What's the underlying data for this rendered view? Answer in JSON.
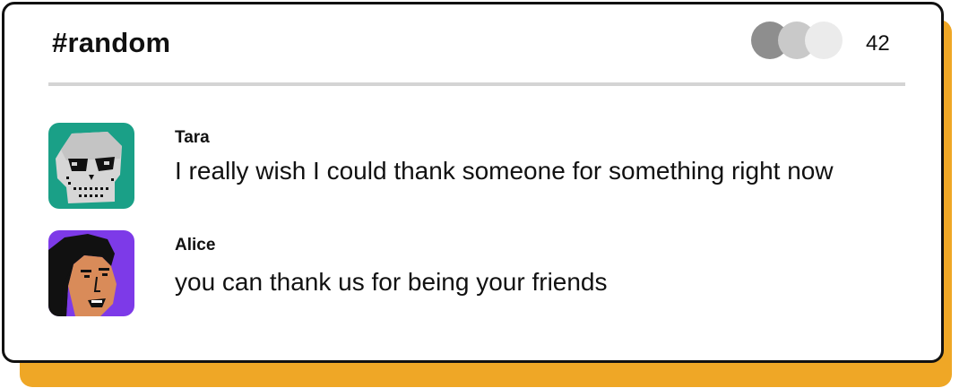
{
  "channel": {
    "title": "#random",
    "member_count": "42"
  },
  "messages": [
    {
      "author": "Tara",
      "text": "I really wish I could thank someone for something right now",
      "avatar_icon": "skull-avatar",
      "avatar_bg": "#1aa087"
    },
    {
      "author": "Alice",
      "text": "you can thank us for being your friends",
      "avatar_icon": "woman-face-avatar",
      "avatar_bg": "#7d3ae8"
    }
  ],
  "colors": {
    "accent_shadow": "#efa726",
    "border": "#111111",
    "divider": "#d4d4d4"
  }
}
